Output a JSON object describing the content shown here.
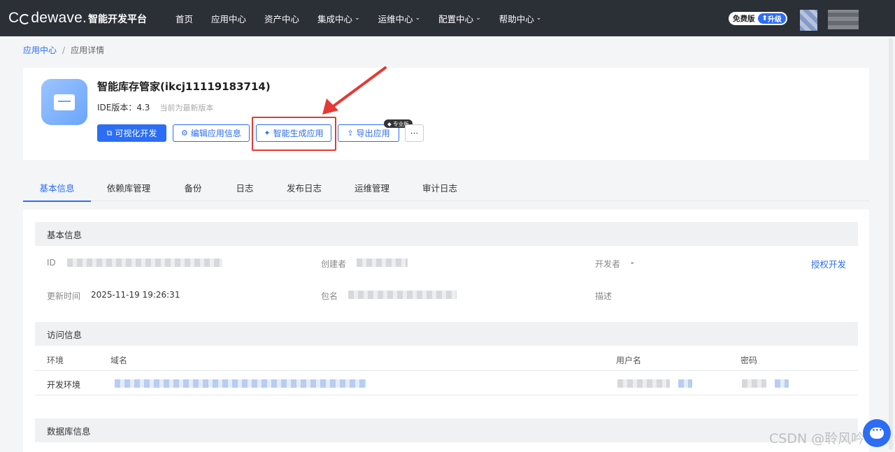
{
  "nav": {
    "logo": "Codewave.",
    "platform": "智能开发平台",
    "items": [
      {
        "label": "首页",
        "has_dropdown": false
      },
      {
        "label": "应用中心",
        "has_dropdown": false
      },
      {
        "label": "资产中心",
        "has_dropdown": false
      },
      {
        "label": "集成中心",
        "has_dropdown": true
      },
      {
        "label": "运维中心",
        "has_dropdown": true
      },
      {
        "label": "配置中心",
        "has_dropdown": true
      },
      {
        "label": "帮助中心",
        "has_dropdown": true
      }
    ],
    "plan": "免费版",
    "upgrade": "升级"
  },
  "breadcrumb": {
    "parent": "应用中心",
    "current": "应用详情",
    "sep": "/"
  },
  "app": {
    "name": "智能库存管家(ikcj11119183714)",
    "ide_label": "IDE版本：4.3",
    "latest_note": "当前为最新版本",
    "buttons": {
      "visual_dev": "可视化开发",
      "edit_info": "编辑应用信息",
      "ai_generate": "智能生成应用",
      "export": "导出应用",
      "more": "···"
    },
    "pro_tag": "专业版"
  },
  "tabs": [
    "基本信息",
    "依赖库管理",
    "备份",
    "日志",
    "发布日志",
    "运维管理",
    "审计日志"
  ],
  "active_tab": 0,
  "basic": {
    "title": "基本信息",
    "id_label": "ID",
    "creator_label": "创建者",
    "developer_label": "开发者",
    "developer_value": "-",
    "authorize": "授权开发",
    "updated_label": "更新时间",
    "updated_value": "2025-11-19 19:26:31",
    "package_label": "包名",
    "desc_label": "描述"
  },
  "access": {
    "title": "访问信息",
    "headers": {
      "env": "环境",
      "domain": "域名",
      "user": "用户名",
      "password": "密码"
    },
    "row_env": "开发环境"
  },
  "database": {
    "title": "数据库信息"
  },
  "watermark": "CSDN @聆风吟"
}
